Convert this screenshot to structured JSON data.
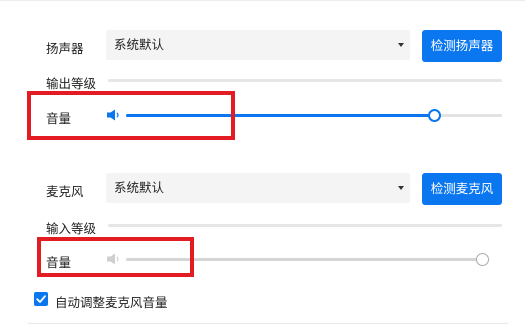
{
  "speaker": {
    "label": "扬声器",
    "device": "系统默认",
    "test_button": "检测扬声器",
    "output_level_label": "输出等级",
    "volume_label": "音量",
    "volume": 0.82
  },
  "microphone": {
    "label": "麦克风",
    "device": "系统默认",
    "test_button": "检测麦克风",
    "input_level_label": "输入等级",
    "volume_label": "音量",
    "volume": 1.0
  },
  "auto_adjust": {
    "label": "自动调整麦克风音量",
    "checked": true
  },
  "colors": {
    "accent": "#0a77f0",
    "highlight": "#e31b23"
  },
  "icons": {
    "speaker_volume": "speaker-icon",
    "mic_volume": "speaker-muted-icon",
    "checkbox": "check-icon",
    "dropdown": "chevron-down-icon"
  }
}
